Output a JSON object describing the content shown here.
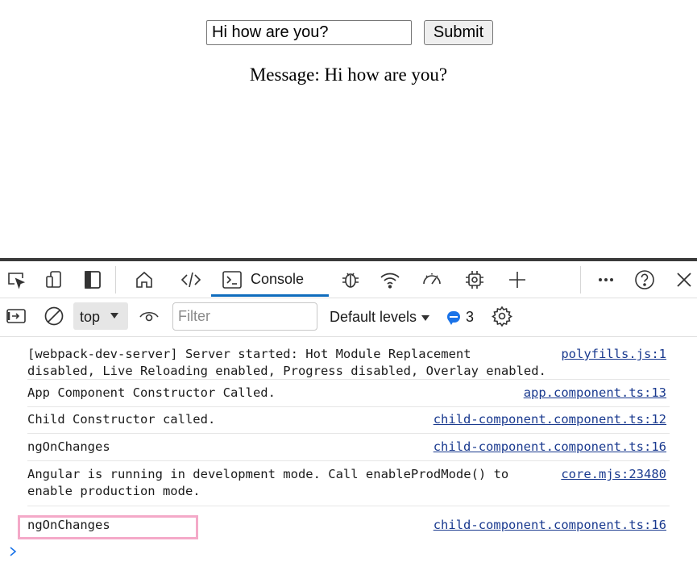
{
  "app": {
    "input_value": "Hi how are you?",
    "submit_label": "Submit",
    "message_line": "Message: Hi how are you?"
  },
  "devtools": {
    "tabs": {
      "console_label": "Console"
    },
    "toolbar": {
      "context": "top",
      "filter_placeholder": "Filter",
      "levels": "Default levels",
      "issues_count": "3"
    },
    "accent_color": "#0f6cbd",
    "messages": [
      {
        "text": "[webpack-dev-server] Server started: Hot Module Replacement\ndisabled, Live Reloading enabled, Progress disabled, Overlay enabled.",
        "source": "polyfills.js:1"
      },
      {
        "text": "App Component Constructor Called.",
        "source": "app.component.ts:13"
      },
      {
        "text": "Child Constructor called.",
        "source": "child-component.component.ts:12"
      },
      {
        "text": "ngOnChanges",
        "source": "child-component.component.ts:16"
      },
      {
        "text": "Angular is running in development mode. Call enableProdMode() to\nenable production mode.",
        "source": "core.mjs:23480"
      },
      {
        "text": "ngOnChanges",
        "source": "child-component.component.ts:16"
      }
    ]
  }
}
